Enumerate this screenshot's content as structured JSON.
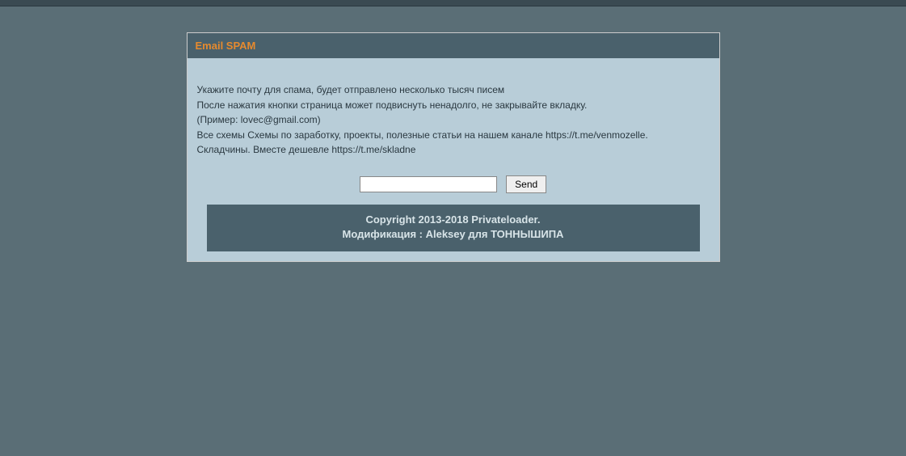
{
  "panel": {
    "title": "Email SPAM",
    "lines": {
      "l1": "Укажите почту для спама, будет отправлено несколько тысяч писем",
      "l2": "После нажатия кнопки страница может подвиснуть ненадолго, не закрывайте вкладку.",
      "l3": "(Пример: lovec@gmail.com)",
      "l4": "Все схемы Схемы по заработку, проекты, полезные статьи на нашем канале https://t.me/venmozelle.",
      "l5": "Складчины. Вместе дешевле https://t.me/skladne"
    }
  },
  "form": {
    "email_value": "",
    "send_label": "Send"
  },
  "footer": {
    "line1": "Copyright 2013-2018 Privateloader.",
    "line2": "Модификация : Aleksey для ТОННЫШИПА"
  }
}
